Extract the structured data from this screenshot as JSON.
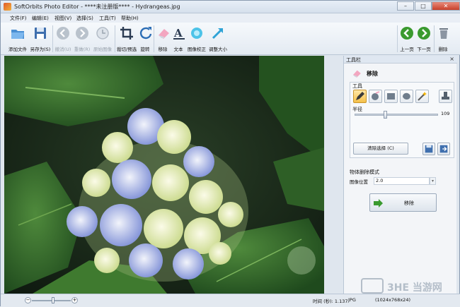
{
  "window": {
    "title": "SoftOrbits Photo Editor - ****未注册版**** - Hydrangeas.jpg",
    "controls": {
      "minimize": "–",
      "maximize": "□",
      "close": "✕"
    }
  },
  "menu": [
    "文件(F)",
    "编辑(E)",
    "视图(V)",
    "选择(S)",
    "工具(T)",
    "帮助(H)"
  ],
  "toolbar": {
    "add_file": "添加文件",
    "save_as": "另存为(S)",
    "undo": "撤消(U)",
    "redo": "重做(R)",
    "restore": "原始图像",
    "crop": "裁切/预选",
    "rotate": "旋转",
    "erase": "移除",
    "text": "文本",
    "correct": "图像校正",
    "resize": "调整大小",
    "prev": "上一页",
    "next": "下一页",
    "delete": "删除"
  },
  "panel": {
    "title": "工具栏",
    "close": "×",
    "section_title": "移除",
    "tools_label": "工具",
    "radius_label": "半径",
    "radius_value": "109",
    "clear_button": "清除选择 (C)",
    "mode_label": "物体删除模式",
    "image_pos_label": "图像位置",
    "image_pos_value": "2.0",
    "remove_button": "移除"
  },
  "status": {
    "zoom_minus": "−",
    "zoom_plus": "+",
    "time": "时间 (秒): 1.137",
    "format": "JPG",
    "dimensions": "(1024x768x24)"
  },
  "watermark": "3HE 当游网",
  "colors": {
    "accent_green": "#3a9a2f",
    "select_yellow": "#f4c04a",
    "panel_bg": "#f3f5f8"
  }
}
